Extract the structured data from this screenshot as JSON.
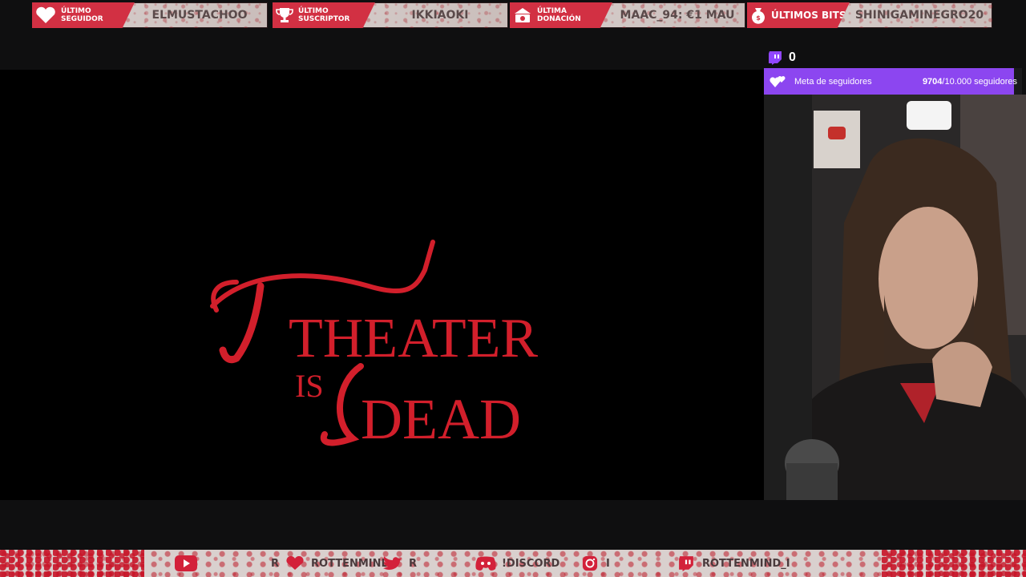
{
  "alerts": [
    {
      "label_line1": "Último",
      "label_line2": "seguidor",
      "value": "ELMUSTACHOO",
      "icon": "heart-icon"
    },
    {
      "label_line1": "Último",
      "label_line2": "suscriptor",
      "value": "IKKIAOKI",
      "icon": "trophy-icon"
    },
    {
      "label_line1": "Última",
      "label_line2": "donación",
      "value": "MAAC_94: €1   MAU",
      "icon": "money-icon"
    },
    {
      "label_line1": "Últimos bits",
      "label_line2": "",
      "value": "SHINIGAMINEGRO20",
      "icon": "bits-icon"
    }
  ],
  "twitch_counter": {
    "icon": "twitch-icon",
    "value": "0"
  },
  "follower_goal": {
    "label": "Meta de seguidores",
    "current": "9704",
    "target_text": "/10.000 seguidores",
    "progress_fraction": 0.9704,
    "icon": "hearts-icon",
    "color": "#8c46f0"
  },
  "video": {
    "title_line1": "THEATER",
    "title_is": "IS",
    "title_line2": "DEAD",
    "title_color": "#d21f2b"
  },
  "bottom_bar": [
    {
      "icon": "youtube-icon",
      "text": "R"
    },
    {
      "icon": "heart-icon",
      "text": "ROTTENMIND"
    },
    {
      "icon": "twitter-icon",
      "text": "R"
    },
    {
      "icon": "discord-icon",
      "text": "!DISCORD"
    },
    {
      "icon": "instagram-icon",
      "text": "I"
    },
    {
      "icon": "twitch-icon",
      "text": "ROTTENMIND_I"
    }
  ],
  "colors": {
    "accent": "#d23043",
    "twitch": "#8c46f0",
    "bar_bg": "#d9d0ce"
  }
}
